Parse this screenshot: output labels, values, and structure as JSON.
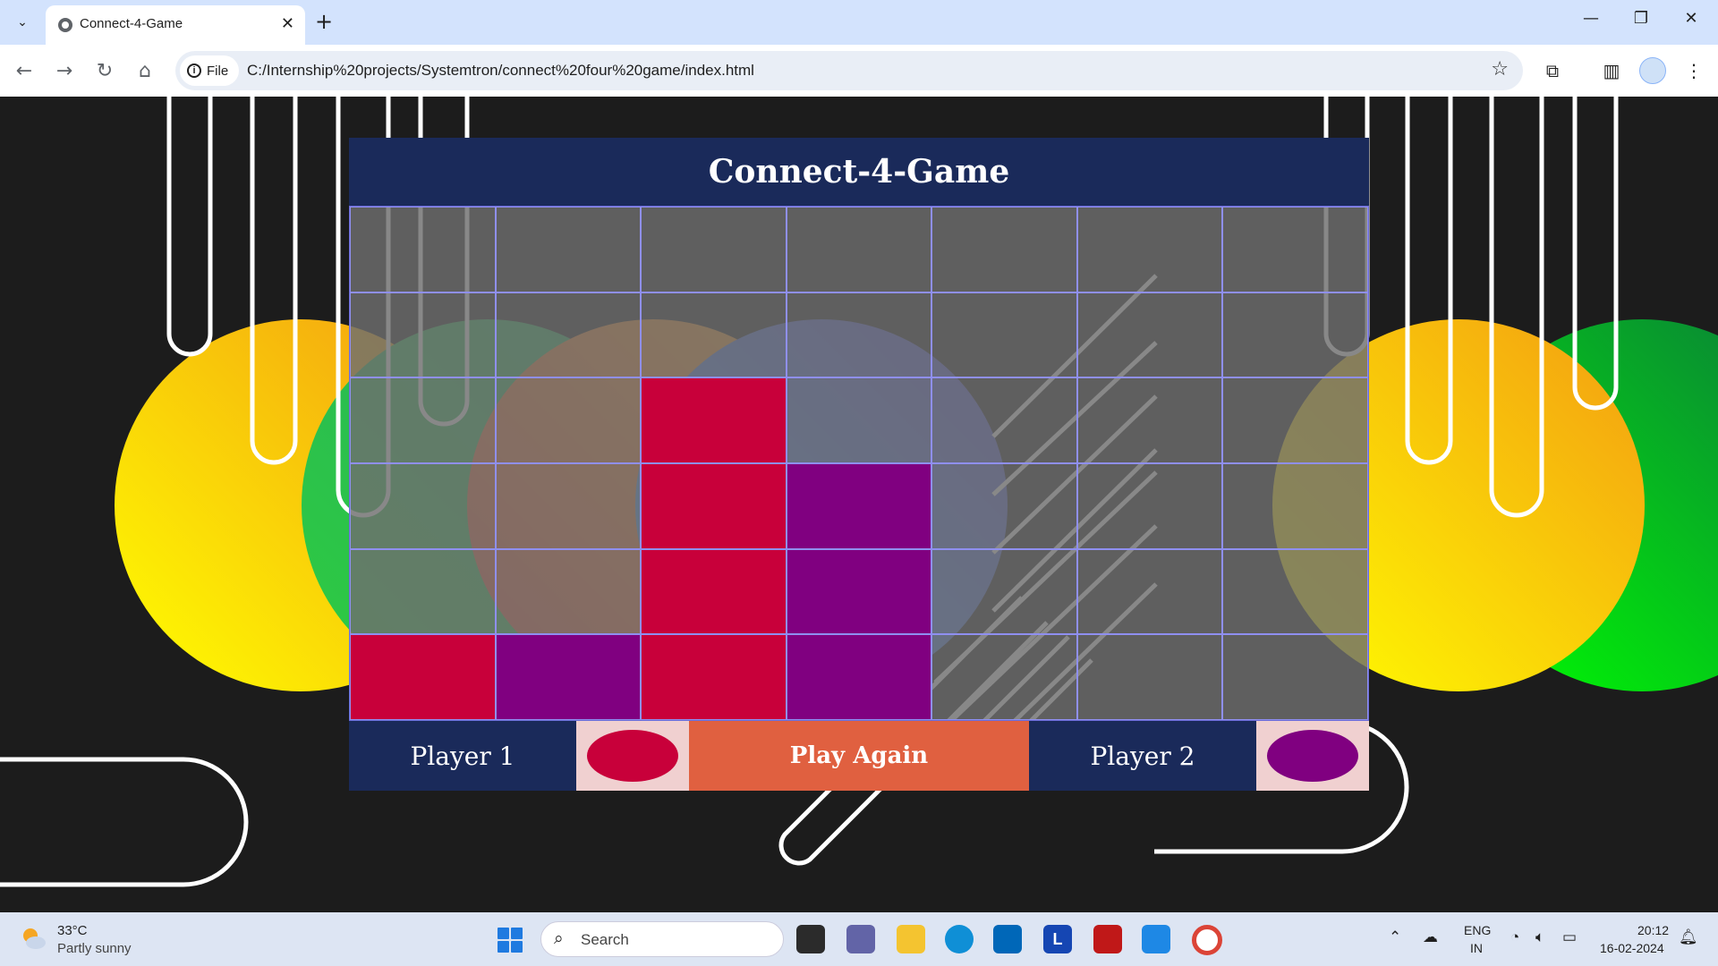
{
  "browser": {
    "tab_title": "Connect-4-Game",
    "site_chip": "File",
    "url": "C:/Internship%20projects/Systemtron/connect%20four%20game/index.html"
  },
  "game": {
    "title": "Connect-4-Game",
    "columns": 7,
    "rows": 6,
    "board": [
      [
        "",
        "",
        "",
        "",
        "",
        "",
        ""
      ],
      [
        "",
        "",
        "",
        "",
        "",
        "",
        ""
      ],
      [
        "",
        "",
        "red",
        "",
        "",
        "",
        ""
      ],
      [
        "",
        "",
        "red",
        "purple",
        "",
        "",
        ""
      ],
      [
        "",
        "",
        "red",
        "purple",
        "",
        "",
        ""
      ],
      [
        "red",
        "purple",
        "red",
        "purple",
        "",
        "",
        ""
      ]
    ],
    "player1_label": "Player 1",
    "player2_label": "Player 2",
    "player1_color": "#c8003a",
    "player2_color": "#800080",
    "play_again_label": "Play Again"
  },
  "taskbar": {
    "weather_temp": "33°C",
    "weather_desc": "Partly sunny",
    "search_placeholder": "Search",
    "lang_line1": "ENG",
    "lang_line2": "IN",
    "time": "20:12",
    "date": "16-02-2024"
  }
}
